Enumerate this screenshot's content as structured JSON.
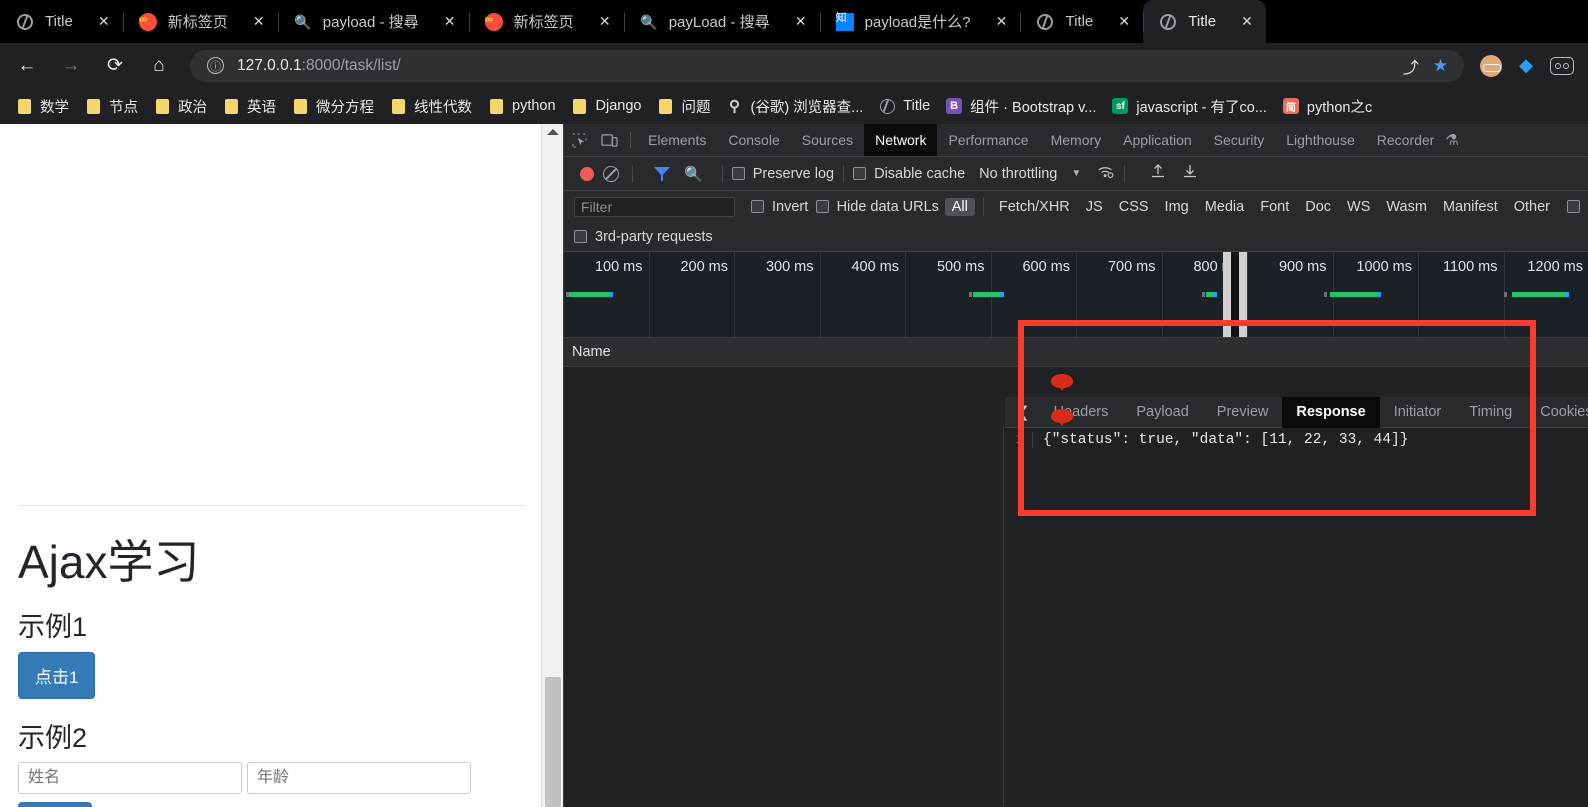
{
  "browser": {
    "tabs": [
      {
        "title": "Title",
        "favicon": "globe-icon",
        "active": false
      },
      {
        "title": "新标签页",
        "favicon": "infinity-icon",
        "active": false
      },
      {
        "title": "payload - 搜尋",
        "favicon": "search-icon",
        "active": false
      },
      {
        "title": "新标签页",
        "favicon": "infinity-icon",
        "active": false
      },
      {
        "title": "payLoad - 搜尋",
        "favicon": "search-icon",
        "active": false
      },
      {
        "title": "payload是什么?",
        "favicon": "zhihu-icon",
        "active": false
      },
      {
        "title": "Title",
        "favicon": "globe-icon",
        "active": false
      },
      {
        "title": "Title",
        "favicon": "globe-icon",
        "active": true
      }
    ],
    "close_label": "✕",
    "nav": {
      "back": "←",
      "forward": "→",
      "reload": "⟳",
      "home": "⌂"
    },
    "omnibox": {
      "info_icon": "ⓘ",
      "url_host": "127.0.0.1",
      "url_path": ":8000/task/list/",
      "share_icon": "share-icon",
      "star_icon": "★"
    },
    "bookmarks": [
      {
        "label": "数学",
        "icon": "folder-icon"
      },
      {
        "label": "节点",
        "icon": "folder-icon"
      },
      {
        "label": "政治",
        "icon": "folder-icon"
      },
      {
        "label": "英语",
        "icon": "folder-icon"
      },
      {
        "label": "微分方程",
        "icon": "folder-icon"
      },
      {
        "label": "线性代数",
        "icon": "folder-icon"
      },
      {
        "label": "python",
        "icon": "folder-icon"
      },
      {
        "label": "Django",
        "icon": "folder-icon"
      },
      {
        "label": "问题",
        "icon": "folder-icon"
      },
      {
        "label": "(谷歌) 浏览器查...",
        "icon": "bird-icon"
      },
      {
        "label": "Title",
        "icon": "globe-icon"
      },
      {
        "label": "组件 · Bootstrap v...",
        "icon": "bootstrap-icon",
        "badge": "B"
      },
      {
        "label": "javascript - 有了co...",
        "icon": "segmentfault-icon",
        "badge": "sf"
      },
      {
        "label": "python之c",
        "icon": "jianshu-icon",
        "badge": "简"
      }
    ]
  },
  "page": {
    "heading": "Ajax学习",
    "section1_title": "示例1",
    "button1_label": "点击1",
    "section2_title": "示例2",
    "name_placeholder": "姓名",
    "age_placeholder": "年龄"
  },
  "devtools": {
    "panel_tabs": [
      {
        "label": "Elements",
        "active": false
      },
      {
        "label": "Console",
        "active": false
      },
      {
        "label": "Sources",
        "active": false
      },
      {
        "label": "Network",
        "active": true
      },
      {
        "label": "Performance",
        "active": false
      },
      {
        "label": "Memory",
        "active": false
      },
      {
        "label": "Application",
        "active": false
      },
      {
        "label": "Security",
        "active": false
      },
      {
        "label": "Lighthouse",
        "active": false
      },
      {
        "label": "Recorder",
        "active": false
      }
    ],
    "beaker_icon": "⚗",
    "toolbar": {
      "record_tooltip": "record",
      "clear_tooltip": "clear",
      "preserve_log": "Preserve log",
      "disable_cache": "Disable cache",
      "throttling": "No throttling",
      "caret": "▼"
    },
    "filter_bar": {
      "filter_placeholder": "Filter",
      "invert": "Invert",
      "hide_data_urls": "Hide data URLs",
      "types": [
        "All",
        "Fetch/XHR",
        "JS",
        "CSS",
        "Img",
        "Media",
        "Font",
        "Doc",
        "WS",
        "Wasm",
        "Manifest",
        "Other"
      ],
      "selected_type": "All",
      "third_party": "3rd-party requests"
    },
    "overview": {
      "ticks": [
        "100 ms",
        "200 ms",
        "300 ms",
        "400 ms",
        "500 ms",
        "600 ms",
        "700 ms",
        "800 ms",
        "900 ms",
        "1000 ms",
        "1100 ms",
        "1200 ms"
      ]
    },
    "request_table": {
      "columns": [
        "Name"
      ],
      "rows": []
    },
    "detail": {
      "back_chevron": "❮",
      "tabs": [
        {
          "label": "Headers",
          "active": false
        },
        {
          "label": "Payload",
          "active": false
        },
        {
          "label": "Preview",
          "active": false
        },
        {
          "label": "Response",
          "active": true
        },
        {
          "label": "Initiator",
          "active": false
        },
        {
          "label": "Timing",
          "active": false
        },
        {
          "label": "Cookies",
          "active": false
        }
      ],
      "response_line_number": "1",
      "response_body": "{\"status\": true, \"data\": [11, 22, 33, 44]}"
    },
    "annotation_color": "#ff3b30"
  }
}
